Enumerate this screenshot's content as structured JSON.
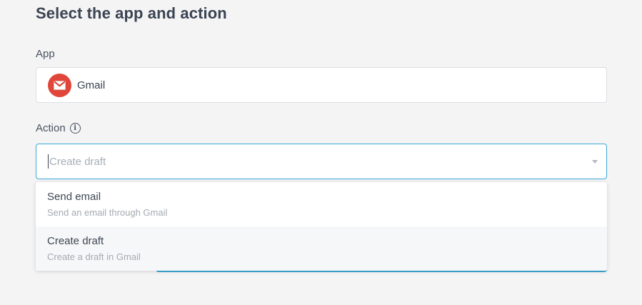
{
  "page": {
    "title": "Select the app and action"
  },
  "app": {
    "label": "App",
    "value": "Gmail",
    "icon": "gmail-icon",
    "brand_color": "#e0473a"
  },
  "action": {
    "label": "Action",
    "info_icon": "info-icon",
    "placeholder": "Create draft",
    "focus_color": "#3ba9d6",
    "options": [
      {
        "title": "Send email",
        "description": "Send an email through Gmail"
      },
      {
        "title": "Create draft",
        "description": "Create a draft in Gmail"
      }
    ],
    "highlighted_option_index": 1
  }
}
